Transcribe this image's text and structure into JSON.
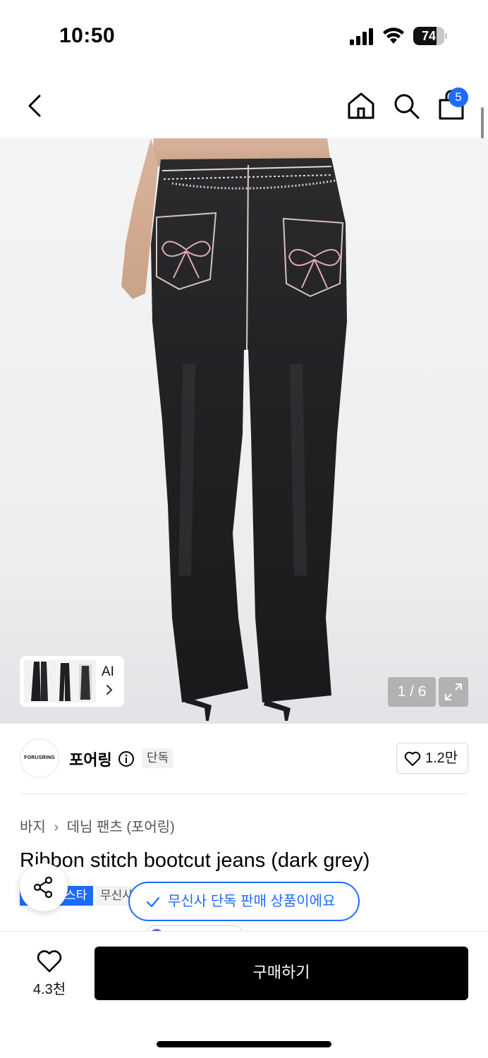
{
  "status_bar": {
    "time": "10:50",
    "battery": "74",
    "battery_level": 0.74
  },
  "nav": {
    "back_icon": "chevron-left-icon",
    "home_icon": "home-icon",
    "search_icon": "search-icon",
    "cart_icon": "shopping-bag-icon",
    "cart_count": "5"
  },
  "gallery": {
    "thumb_label": "AI",
    "pager": "1 / 6",
    "expand_icon": "expand-icon"
  },
  "brand": {
    "logo_text": "FORUSRING",
    "name": "포어링",
    "exclusive_tag": "단독",
    "likes": "1.2만"
  },
  "product": {
    "breadcrumb": [
      "바지",
      "데님 팬츠 (포어링)"
    ],
    "title": "Ribbon stitch bootcut jeans (dark grey)",
    "badges": [
      "스타",
      "무신사"
    ]
  },
  "toast": {
    "text": "무신사 단독 판매 상품이에요"
  },
  "bottom": {
    "wish_count": "4.3천",
    "buy_label": "구매하기"
  },
  "colors": {
    "accent": "#1e6bff",
    "primary_button": "#000000",
    "purple_badge": "#8a4dff"
  }
}
